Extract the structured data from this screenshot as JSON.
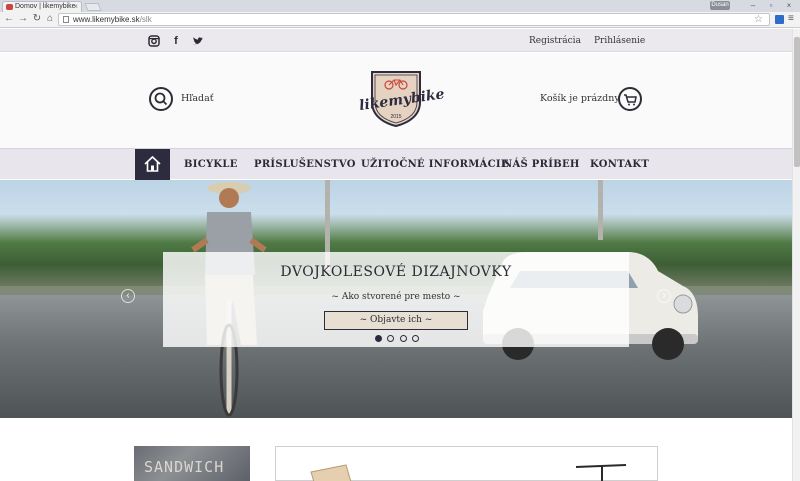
{
  "browser": {
    "tab_title": "Domov | likemybike",
    "url_host": "www.likemybike.sk",
    "url_path": "/slk",
    "user_badge": "Dusan",
    "icons": [
      "back-icon",
      "forward-icon",
      "reload-icon",
      "home-icon",
      "bookmark-star-icon",
      "menu-icon"
    ]
  },
  "topbar": {
    "social": [
      "instagram-icon",
      "facebook-icon",
      "twitter-icon"
    ],
    "register": "Registrácia",
    "login": "Prihlásenie"
  },
  "header": {
    "search_label": "Hľadať",
    "logo_text": "likemybike",
    "logo_year": "2015",
    "cart_label": "Košík je prázdny"
  },
  "nav": {
    "items": [
      "BICYKLE",
      "PRÍSLUŠENSTVO",
      "UŽITOČNÉ INFORMÁCIE",
      "NÁŠ PRÍBEH",
      "KONTAKT"
    ]
  },
  "hero": {
    "title": "DVOJKOLESOVÉ DIZAJNOVKY",
    "subtitle": "~ Ako stvorené pre mesto ~",
    "button": "~ Objavte ich ~",
    "slides": 4,
    "active_slide": 1
  },
  "below": {
    "sandwich_text": "SANDWICH"
  },
  "colors": {
    "brand_dark": "#2d2c3f",
    "nav_bg": "#e8e5ec",
    "accent_red": "#c9463d"
  }
}
